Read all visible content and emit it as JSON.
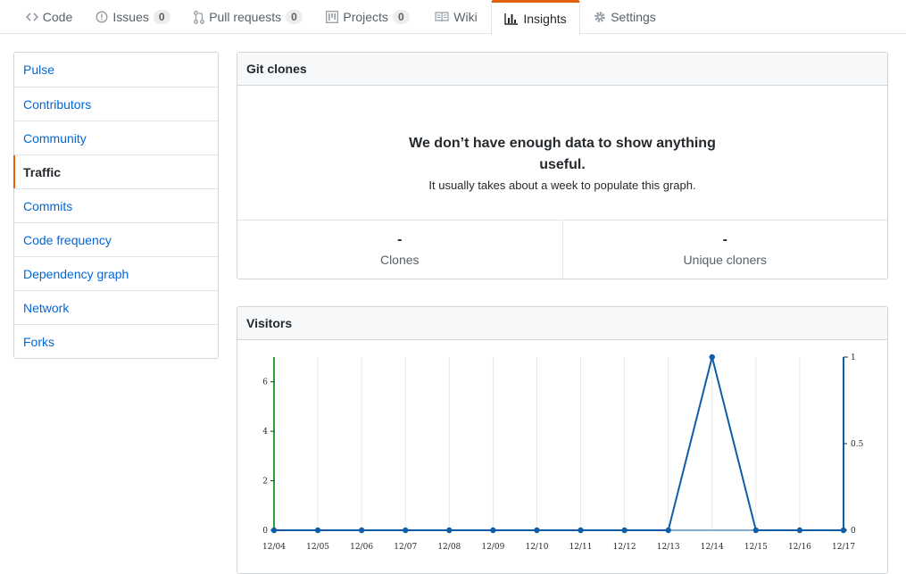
{
  "tabs": [
    {
      "id": "code",
      "label": "Code",
      "icon": "code-icon"
    },
    {
      "id": "issues",
      "label": "Issues",
      "icon": "issue-opened-icon",
      "count": "0"
    },
    {
      "id": "pulls",
      "label": "Pull requests",
      "icon": "git-pull-request-icon",
      "count": "0"
    },
    {
      "id": "projects",
      "label": "Projects",
      "icon": "project-icon",
      "count": "0"
    },
    {
      "id": "wiki",
      "label": "Wiki",
      "icon": "book-icon"
    },
    {
      "id": "insights",
      "label": "Insights",
      "icon": "graph-icon",
      "selected": true
    },
    {
      "id": "settings",
      "label": "Settings",
      "icon": "gear-icon"
    }
  ],
  "sidebar": {
    "items": [
      {
        "label": "Pulse"
      },
      {
        "label": "Contributors"
      },
      {
        "label": "Community"
      },
      {
        "label": "Traffic",
        "selected": true
      },
      {
        "label": "Commits"
      },
      {
        "label": "Code frequency"
      },
      {
        "label": "Dependency graph"
      },
      {
        "label": "Network"
      },
      {
        "label": "Forks"
      }
    ]
  },
  "clones": {
    "title": "Git clones",
    "blank_heading": "We don’t have enough data to show anything useful.",
    "blank_text": "It usually takes about a week to populate this graph.",
    "stats": [
      {
        "value": "-",
        "label": "Clones"
      },
      {
        "value": "-",
        "label": "Unique cloners"
      }
    ]
  },
  "visitors": {
    "title": "Visitors"
  },
  "colors": {
    "accent": "#e36209",
    "link": "#0366d6",
    "series_line": "#0d5ea6",
    "left_axis": "#2ca02c"
  },
  "chart_data": {
    "type": "line",
    "x": [
      "12/04",
      "12/05",
      "12/06",
      "12/07",
      "12/08",
      "12/09",
      "12/10",
      "12/11",
      "12/12",
      "12/13",
      "12/14",
      "12/15",
      "12/16",
      "12/17"
    ],
    "series": [
      {
        "values": [
          0,
          0,
          0,
          0,
          0,
          0,
          0,
          0,
          0,
          0,
          7,
          0,
          0,
          0
        ]
      }
    ],
    "y_left": {
      "ticks": [
        0,
        2,
        4,
        6
      ],
      "range": [
        0,
        7
      ]
    },
    "y_right": {
      "ticks": [
        "0",
        "0.5",
        "1"
      ],
      "range": [
        0,
        1
      ]
    },
    "grid": true
  }
}
